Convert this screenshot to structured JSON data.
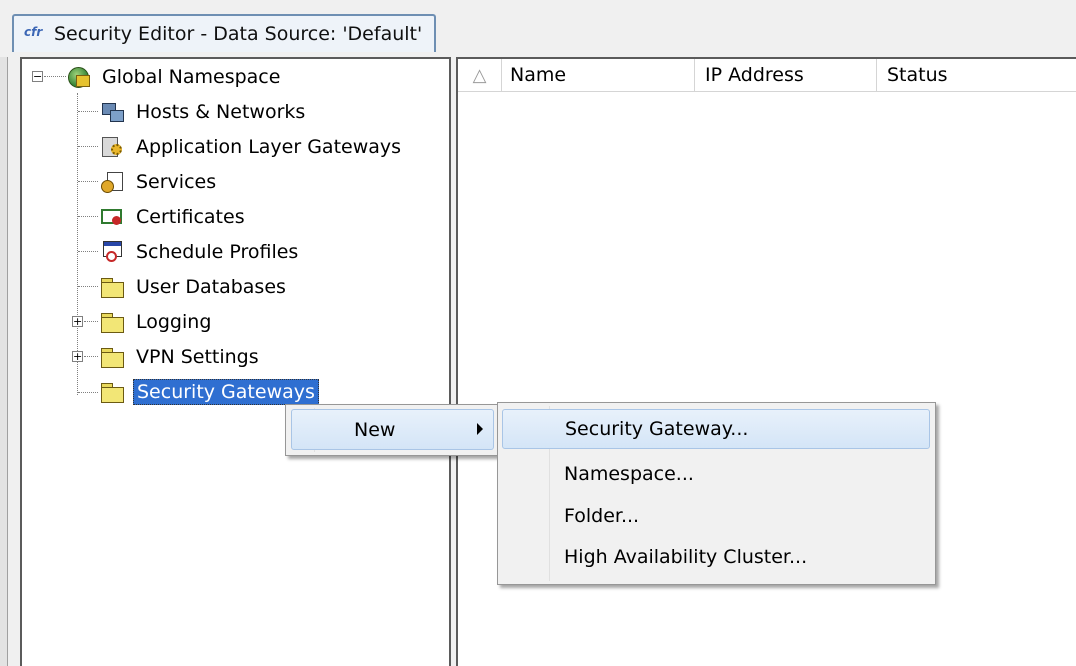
{
  "window": {
    "title": "Security Editor - Data Source: 'Default'",
    "app_icon_glyph": "cfr"
  },
  "tree": {
    "root": {
      "label": "Global Namespace",
      "expander": "−",
      "icon": "globe-key-icon"
    },
    "items": [
      {
        "label": "Hosts & Networks",
        "icon": "hosts-networks-icon"
      },
      {
        "label": "Application Layer Gateways",
        "icon": "gateway-gear-icon"
      },
      {
        "label": "Services",
        "icon": "services-icon"
      },
      {
        "label": "Certificates",
        "icon": "certificate-icon"
      },
      {
        "label": "Schedule Profiles",
        "icon": "schedule-clock-icon"
      },
      {
        "label": "User Databases",
        "icon": "folder-icon"
      },
      {
        "label": "Logging",
        "icon": "folder-icon",
        "expander": "+"
      },
      {
        "label": "VPN Settings",
        "icon": "folder-icon",
        "expander": "+"
      },
      {
        "label": "Security Gateways",
        "icon": "folder-icon",
        "selected": true
      }
    ]
  },
  "list": {
    "sort_glyph": "△",
    "columns": [
      "Name",
      "IP Address",
      "Status"
    ]
  },
  "context_menu": {
    "items": [
      {
        "label": "New",
        "has_submenu": true
      }
    ]
  },
  "submenu": {
    "items": [
      {
        "label": "Security Gateway...",
        "highlighted": true
      },
      {
        "label": "Namespace..."
      },
      {
        "label": "Folder..."
      },
      {
        "label": "High Availability Cluster..."
      }
    ]
  },
  "colors": {
    "selection": "#2f6fd1",
    "menu_highlight": "#d4e5f7",
    "pane_border": "#5b5b5b"
  }
}
